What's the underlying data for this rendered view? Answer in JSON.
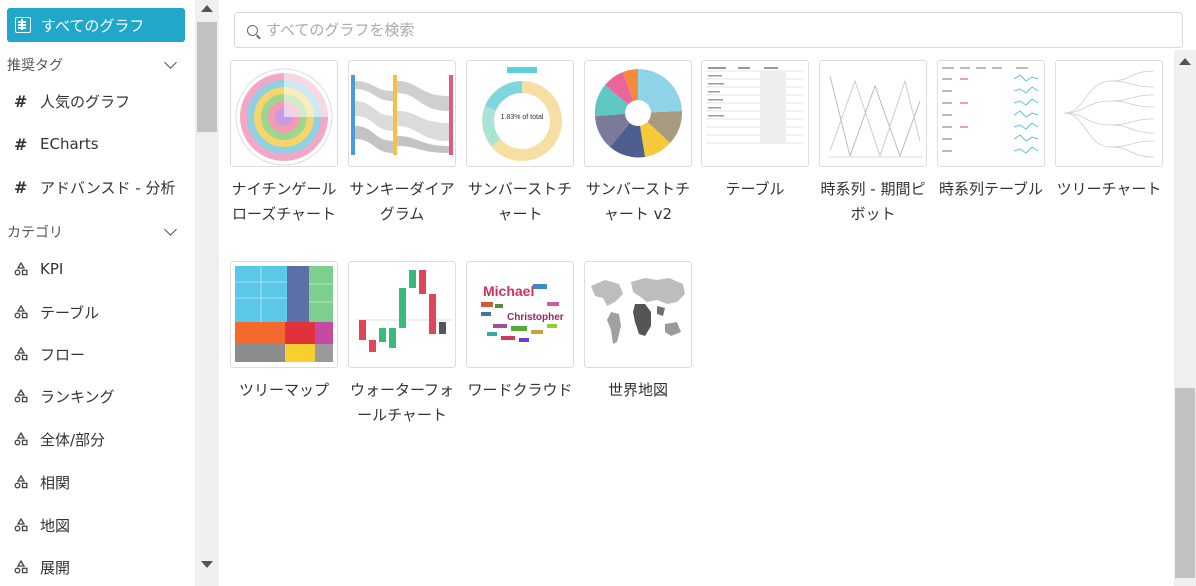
{
  "sidebar": {
    "all_label": "すべてのグラフ",
    "recommended_header": "推奨タグ",
    "recommended": [
      {
        "label": "人気のグラフ"
      },
      {
        "label": "ECharts"
      },
      {
        "label": "アドバンスド - 分析"
      }
    ],
    "category_header": "カテゴリ",
    "categories": [
      {
        "label": "KPI"
      },
      {
        "label": "テーブル"
      },
      {
        "label": "フロー"
      },
      {
        "label": "ランキング"
      },
      {
        "label": "全体/部分"
      },
      {
        "label": "相関"
      },
      {
        "label": "地図"
      },
      {
        "label": "展開"
      }
    ]
  },
  "search": {
    "placeholder": "すべてのグラフを検索"
  },
  "charts": [
    {
      "label": "ナイチンゲールローズチャート",
      "icon": "nightingale-rose-thumbnail"
    },
    {
      "label": "サンキーダイアグラム",
      "icon": "sankey-thumbnail"
    },
    {
      "label": "サンバーストチャート",
      "icon": "sunburst-thumbnail"
    },
    {
      "label": "サンバーストチャート v2",
      "icon": "sunburst-v2-thumbnail"
    },
    {
      "label": "テーブル",
      "icon": "table-thumbnail"
    },
    {
      "label": "時系列 - 期間ピボット",
      "icon": "time-pivot-thumbnail"
    },
    {
      "label": "時系列テーブル",
      "icon": "time-series-table-thumbnail"
    },
    {
      "label": "ツリーチャート",
      "icon": "tree-chart-thumbnail"
    },
    {
      "label": "ツリーマップ",
      "icon": "treemap-thumbnail"
    },
    {
      "label": "ウォーターフォールチャート",
      "icon": "waterfall-thumbnail"
    },
    {
      "label": "ワードクラウド",
      "icon": "word-cloud-thumbnail"
    },
    {
      "label": "世界地図",
      "icon": "world-map-thumbnail"
    }
  ],
  "thumb_text": {
    "sunburst_center_1": "1.83% of total",
    "word_1": "Michael",
    "word_2": "Christopher"
  },
  "colors": {
    "accent": "#20a7c9"
  }
}
